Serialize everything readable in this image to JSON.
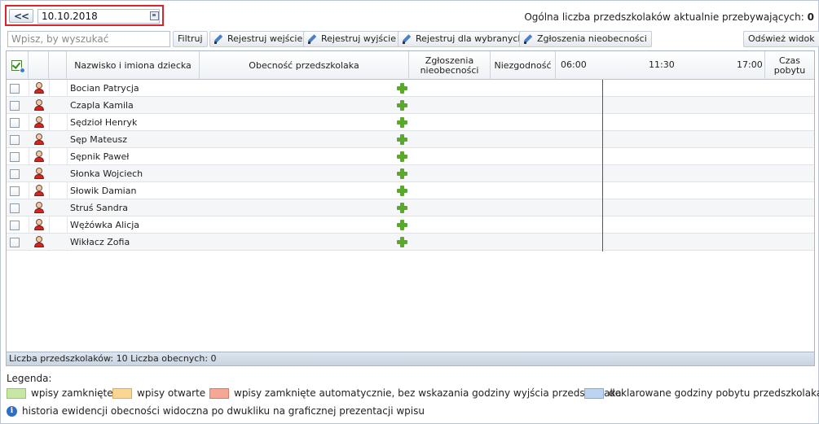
{
  "header": {
    "back_label": "<<",
    "date_value": "10.10.2018",
    "total_label": "Ogólna liczba przedszkolaków aktualnie przebywających:",
    "total_value": "0"
  },
  "toolbar": {
    "search_placeholder": "Wpisz, by wyszukać",
    "filter_label": "Filtruj",
    "register_entry_label": "Rejestruj wejście",
    "register_exit_label": "Rejestruj wyjście",
    "register_selected_label": "Rejestruj dla wybranych",
    "absence_reports_label": "Zgłoszenia nieobecności",
    "refresh_label": "Odśwież widok"
  },
  "table": {
    "columns": {
      "name": "Nazwisko i imiona dziecka",
      "presence": "Obecność przedszkolaka",
      "absence_reports": "Zgłoszenia nieobecności",
      "discrepancy": "Niezgodność",
      "time_0600": "06:00",
      "time_1130": "11:30",
      "time_1700": "17:00",
      "stay_time": "Czas pobytu"
    },
    "rows": [
      {
        "name": "Bocian Patrycja"
      },
      {
        "name": "Czapla Kamila"
      },
      {
        "name": "Sędzioł Henryk"
      },
      {
        "name": "Sęp Mateusz"
      },
      {
        "name": "Sępnik Paweł"
      },
      {
        "name": "Słonka Wojciech"
      },
      {
        "name": "Słowik Damian"
      },
      {
        "name": "Struś Sandra"
      },
      {
        "name": "Wężówka Alicja"
      },
      {
        "name": "Wikłacz Zofia"
      }
    ],
    "footer": "Liczba przedszkolaków: 10 Liczba obecnych: 0"
  },
  "legend": {
    "title": "Legenda:",
    "items": [
      {
        "label": "wpisy zamknięte",
        "color": "#c8e6a4",
        "border": "#9cc46e"
      },
      {
        "label": "wpisy otwarte",
        "color": "#fbd692",
        "border": "#e0ad55"
      },
      {
        "label": "wpisy zamknięte automatycznie, bez wskazania godziny wyjścia przedszkolaka",
        "color": "#f6a793",
        "border": "#dd7a63"
      },
      {
        "label": "deklarowane godziny pobytu przedszkolaka",
        "color": "#bcd3f2",
        "border": "#87a9d8"
      }
    ],
    "info": "historia ewidencji obecności widoczna po dwukliku na graficznej prezentacji wpisu"
  }
}
